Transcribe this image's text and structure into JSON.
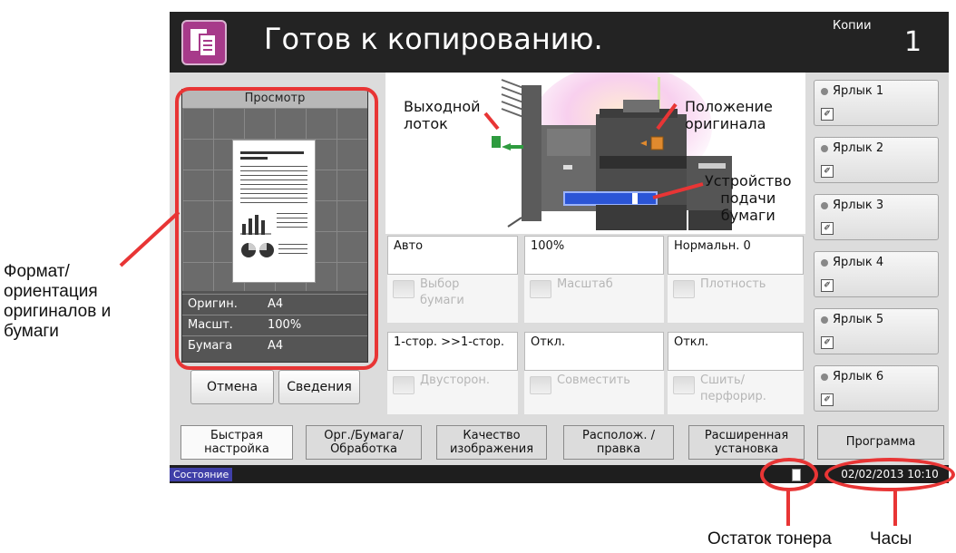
{
  "header": {
    "title": "Готов к копированию.",
    "copies_label": "Копии",
    "copies_value": "1"
  },
  "preview": {
    "title": "Просмотр",
    "rows": [
      {
        "label": "Оригин.",
        "value": "A4"
      },
      {
        "label": "Масшт.",
        "value": "100%"
      },
      {
        "label": "Бумага",
        "value": "A4"
      }
    ],
    "cancel_label": "Отмена",
    "details_label": "Сведения"
  },
  "device_labels": {
    "output_tray": [
      "Выходной",
      "лоток"
    ],
    "original_position": [
      "Положение",
      "оригинала"
    ],
    "paper_feeder": [
      "Устройство",
      "подачи",
      "бумаги"
    ]
  },
  "settings_values": [
    "Авто",
    "100%",
    "Нормальн. 0"
  ],
  "settings_functions": [
    {
      "label": "Выбор бумаги",
      "icon": "paper-icon"
    },
    {
      "label": "Масштаб",
      "icon": "zoom-icon"
    },
    {
      "label": "Плотность",
      "icon": "density-icon"
    }
  ],
  "settings_values2": [
    "1-стор. >>1-стор.",
    "Откл.",
    "Откл."
  ],
  "settings_functions2": [
    {
      "label": "Двусторон.",
      "icon": "duplex-icon"
    },
    {
      "label": "Совместить",
      "icon": "combine-icon"
    },
    {
      "label": "Сшить/ перфорир.",
      "icon": "staple-icon"
    }
  ],
  "shortcuts": [
    "Ярлык 1",
    "Ярлык 2",
    "Ярлык 3",
    "Ярлык 4",
    "Ярлык 5",
    "Ярлык 6"
  ],
  "tabs": [
    "Быстрая настройка",
    "Орг./Бумага/ Обработка",
    "Качество изображения",
    "Располож. /правка",
    "Расширенная установка",
    "Программа"
  ],
  "status": {
    "label": "Состояние",
    "clock": "02/02/2013 10:10"
  },
  "annotations": {
    "format_orientation": [
      "Формат/",
      "ориентация",
      "оригиналов и",
      "бумаги"
    ],
    "toner": "Остаток тонера",
    "clock": "Часы"
  },
  "colors": {
    "header_bg": "#232323",
    "accent_magenta": "#a73a8a",
    "status_blue": "#3f3fa8",
    "callout_red": "#e83535"
  }
}
